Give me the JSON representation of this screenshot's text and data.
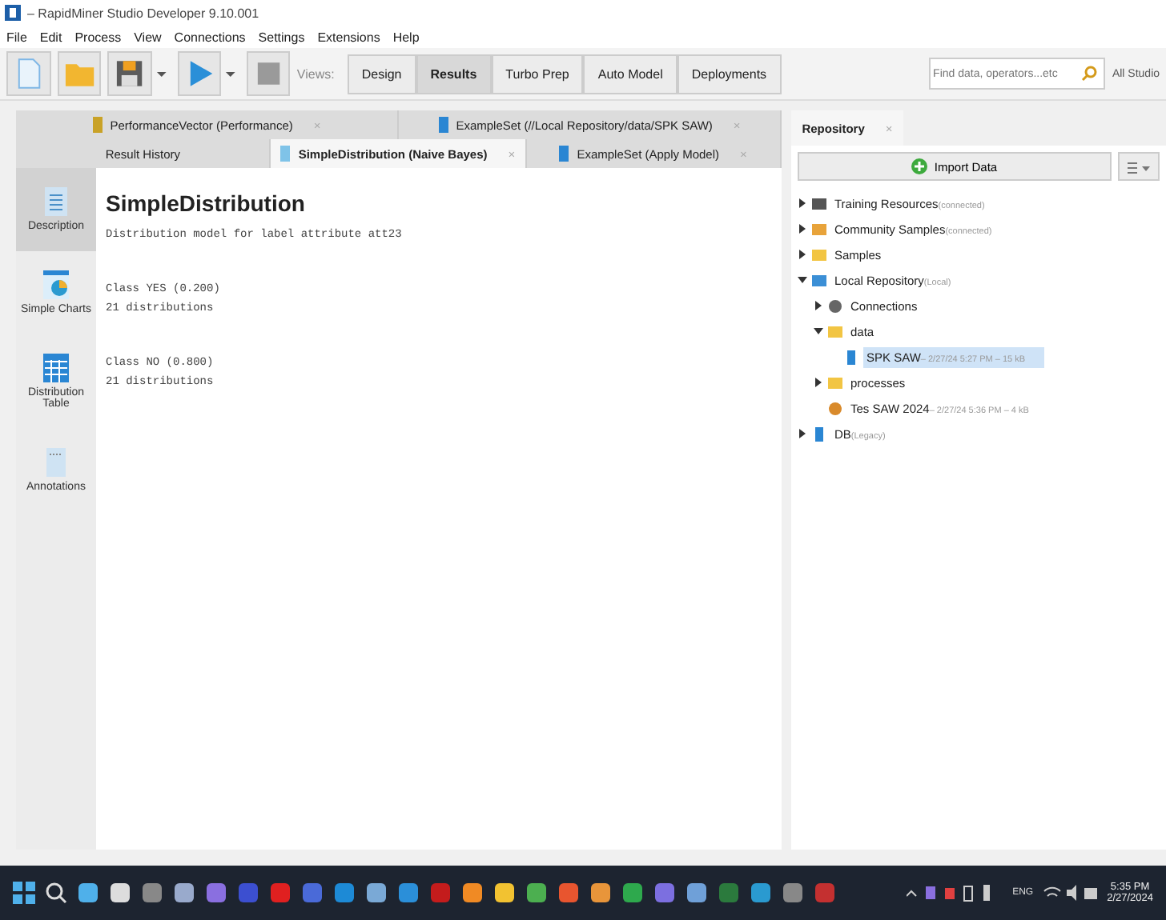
{
  "window": {
    "title": "– RapidMiner Studio Developer 9.10.001"
  },
  "menu": [
    "File",
    "Edit",
    "Process",
    "View",
    "Connections",
    "Settings",
    "Extensions",
    "Help"
  ],
  "views": {
    "label": "Views:",
    "items": [
      {
        "label": "Design",
        "selected": false
      },
      {
        "label": "Results",
        "selected": true
      },
      {
        "label": "Turbo Prep",
        "selected": false
      },
      {
        "label": "Auto Model",
        "selected": false
      },
      {
        "label": "Deployments",
        "selected": false
      }
    ]
  },
  "search": {
    "placeholder": "Find data, operators...etc",
    "scope": "All Studio"
  },
  "result_tabs_top": [
    {
      "label": "PerformanceVector (Performance)",
      "close": "×",
      "selected": false,
      "kind": "perf"
    },
    {
      "label": "ExampleSet (//Local Repository/data/SPK SAW)",
      "close": "×",
      "selected": false,
      "kind": "data"
    }
  ],
  "result_tabs_bottom": [
    {
      "label": "Result History",
      "selected": false,
      "kind": "plain"
    },
    {
      "label": "SimpleDistribution (Naive Bayes)",
      "close": "×",
      "selected": true,
      "kind": "model"
    },
    {
      "label": "ExampleSet (Apply Model)",
      "close": "×",
      "selected": false,
      "kind": "data"
    }
  ],
  "side_views": [
    {
      "label": "Description",
      "selected": true,
      "kind": "doc"
    },
    {
      "label": "Simple Charts",
      "selected": false,
      "kind": "chart"
    },
    {
      "label": "Distribution Table",
      "selected": false,
      "kind": "table"
    },
    {
      "label": "Annotations",
      "selected": false,
      "kind": "note"
    }
  ],
  "model": {
    "title": "SimpleDistribution",
    "description": "Distribution model for label attribute att23",
    "classes": [
      {
        "heading": "Class YES (0.200)",
        "detail": "21 distributions"
      },
      {
        "heading": "Class NO (0.800)",
        "detail": "21 distributions"
      }
    ]
  },
  "repository": {
    "tab": "Repository",
    "tab_close": "×",
    "import_button": "Import Data",
    "tree": [
      {
        "name": "Training Resources",
        "note": "(connected)",
        "kind": "training",
        "expanded": false,
        "selected": false
      },
      {
        "name": "Community Samples",
        "note": "(connected)",
        "kind": "community",
        "expanded": false,
        "selected": false
      },
      {
        "name": "Samples",
        "kind": "folder",
        "expanded": false,
        "selected": false
      },
      {
        "name": "Local Repository",
        "note": "(Local)",
        "kind": "repo",
        "expanded": true,
        "selected": false,
        "children": [
          {
            "name": "Connections",
            "kind": "connections",
            "expanded": false,
            "selected": false
          },
          {
            "name": "data",
            "kind": "folder",
            "expanded": true,
            "selected": false,
            "children": [
              {
                "name": "SPK SAW",
                "note": "– 2/27/24 5:27 PM – 15 kB",
                "kind": "data",
                "selected": true
              }
            ]
          },
          {
            "name": "processes",
            "kind": "folder",
            "expanded": false,
            "selected": false
          },
          {
            "name": "Tes SAW 2024",
            "note": "– 2/27/24 5:36 PM – 4 kB",
            "kind": "process",
            "selected": false
          }
        ]
      },
      {
        "name": "DB",
        "note": "(Legacy)",
        "kind": "db",
        "expanded": false,
        "selected": false
      }
    ]
  },
  "taskbar": {
    "language": "ENG",
    "time": "5:35 PM",
    "date": "2/27/2024"
  }
}
